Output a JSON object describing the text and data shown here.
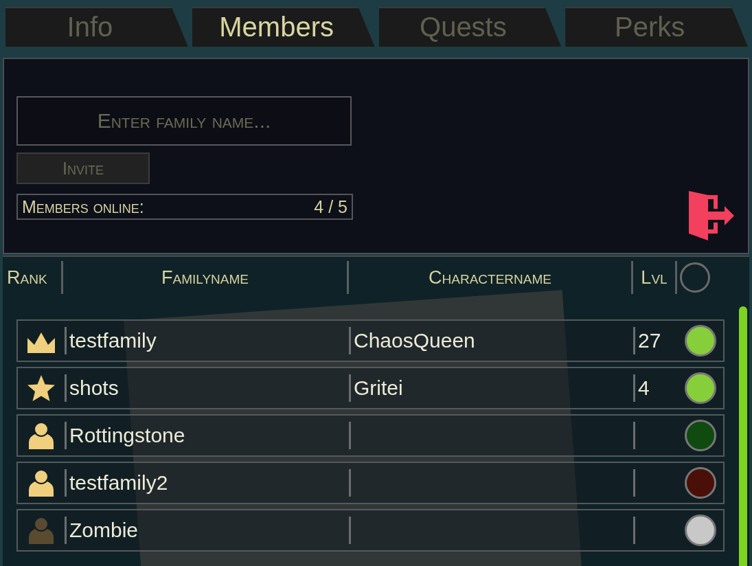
{
  "tabs": [
    {
      "label": "Info",
      "selected": false
    },
    {
      "label": "Members",
      "selected": true
    },
    {
      "label": "Quests",
      "selected": false
    },
    {
      "label": "Perks",
      "selected": false
    }
  ],
  "invite": {
    "placeholder": "Enter family name...",
    "button": "Invite",
    "online_label": "Members online:",
    "online_count": "4 / 5"
  },
  "table": {
    "columns": [
      "Rank",
      "Familyname",
      "Charactername",
      "Lvl"
    ],
    "rows": [
      {
        "kind": "crown",
        "active": true,
        "family": "testfamily",
        "character": "ChaosQueen",
        "level": "27",
        "color": "#86cf3a"
      },
      {
        "kind": "star",
        "active": true,
        "family": "shots",
        "character": "Gritei",
        "level": "4",
        "color": "#86cf3a"
      },
      {
        "kind": "person",
        "active": true,
        "family": "Rottingstone",
        "color": "#0f4a10"
      },
      {
        "kind": "person",
        "active": true,
        "family": "testfamily2",
        "color": "#4a0f08"
      },
      {
        "kind": "person",
        "active": false,
        "family": "Zombie",
        "color": "#c8c8c8"
      }
    ]
  }
}
